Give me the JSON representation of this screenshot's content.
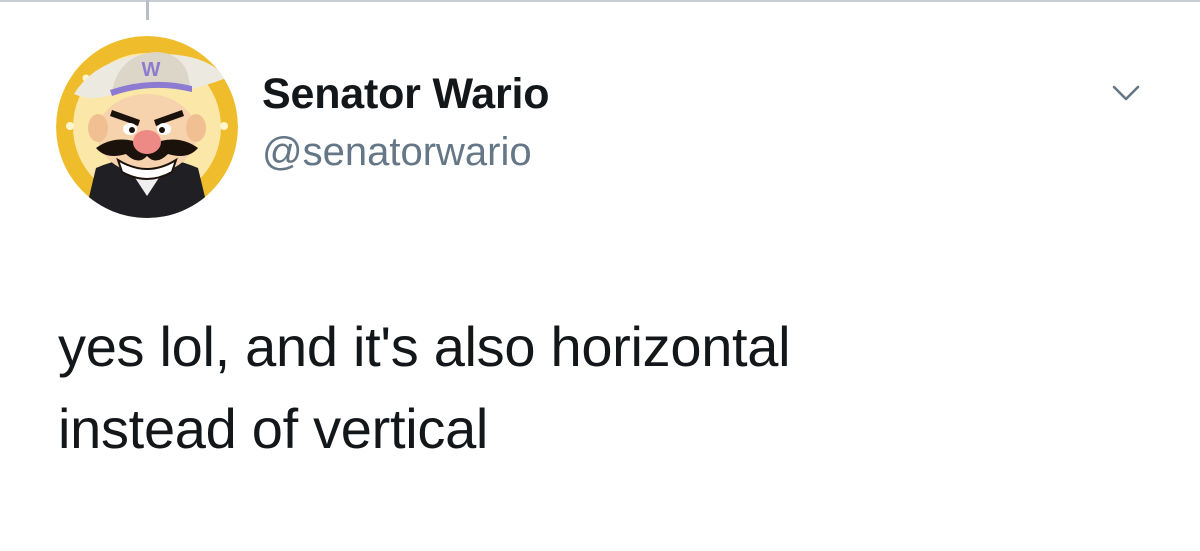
{
  "tweet": {
    "author": {
      "display_name": "Senator Wario",
      "handle": "@senatorwario",
      "avatar_icon": "wario-cowboy-avatar"
    },
    "menu_icon": "chevron-down-icon",
    "text_lines": [
      "yes lol, and it's also horizontal",
      "instead of vertical"
    ]
  },
  "colors": {
    "text_primary": "#14171a",
    "text_secondary": "#657786",
    "avatar_ring": "#f2c230",
    "avatar_bg": "#fbe9a6",
    "divider": "#c9ced3"
  }
}
